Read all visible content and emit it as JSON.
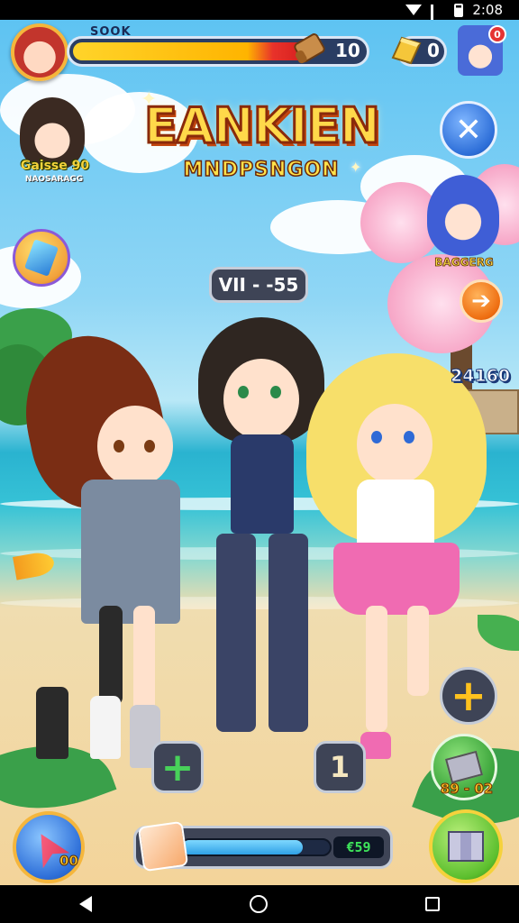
{
  "status_bar": {
    "time": "2:08"
  },
  "hud": {
    "player_name": "SOOK",
    "hp_fraction": 0.8,
    "hp_value": "10",
    "gold_value": "0",
    "notification_badge": "0"
  },
  "npc_left": {
    "label": "Gaisse 90",
    "sublabel": "NAOSARAGG"
  },
  "logo": {
    "title": "EANKIEN",
    "subtitle": "MNDPSNGON"
  },
  "stage": {
    "label": "VII - -55"
  },
  "npc_right": {
    "label": "BAGGERG"
  },
  "score_right": "24160",
  "buttons": {
    "count_value": "1",
    "book_label": "89 - 02",
    "rocket_label": "00"
  },
  "energy": {
    "fraction": 0.82,
    "value": "€59"
  },
  "colors": {
    "sky": "#5ec3f2",
    "sea": "#2ab3d0",
    "sand": "#f3d49a",
    "hud_dark": "#3e4456",
    "gold": "#ffd94a"
  },
  "icons": {
    "close": "x-icon",
    "arrow": "arrow-right-icon",
    "plus": "plus-icon",
    "crystal": "crystal-icon",
    "rocket": "rocket-icon",
    "map": "map-icon",
    "book": "book-icon",
    "scroll": "scroll-icon",
    "gold_bar": "gold-bar-icon"
  }
}
